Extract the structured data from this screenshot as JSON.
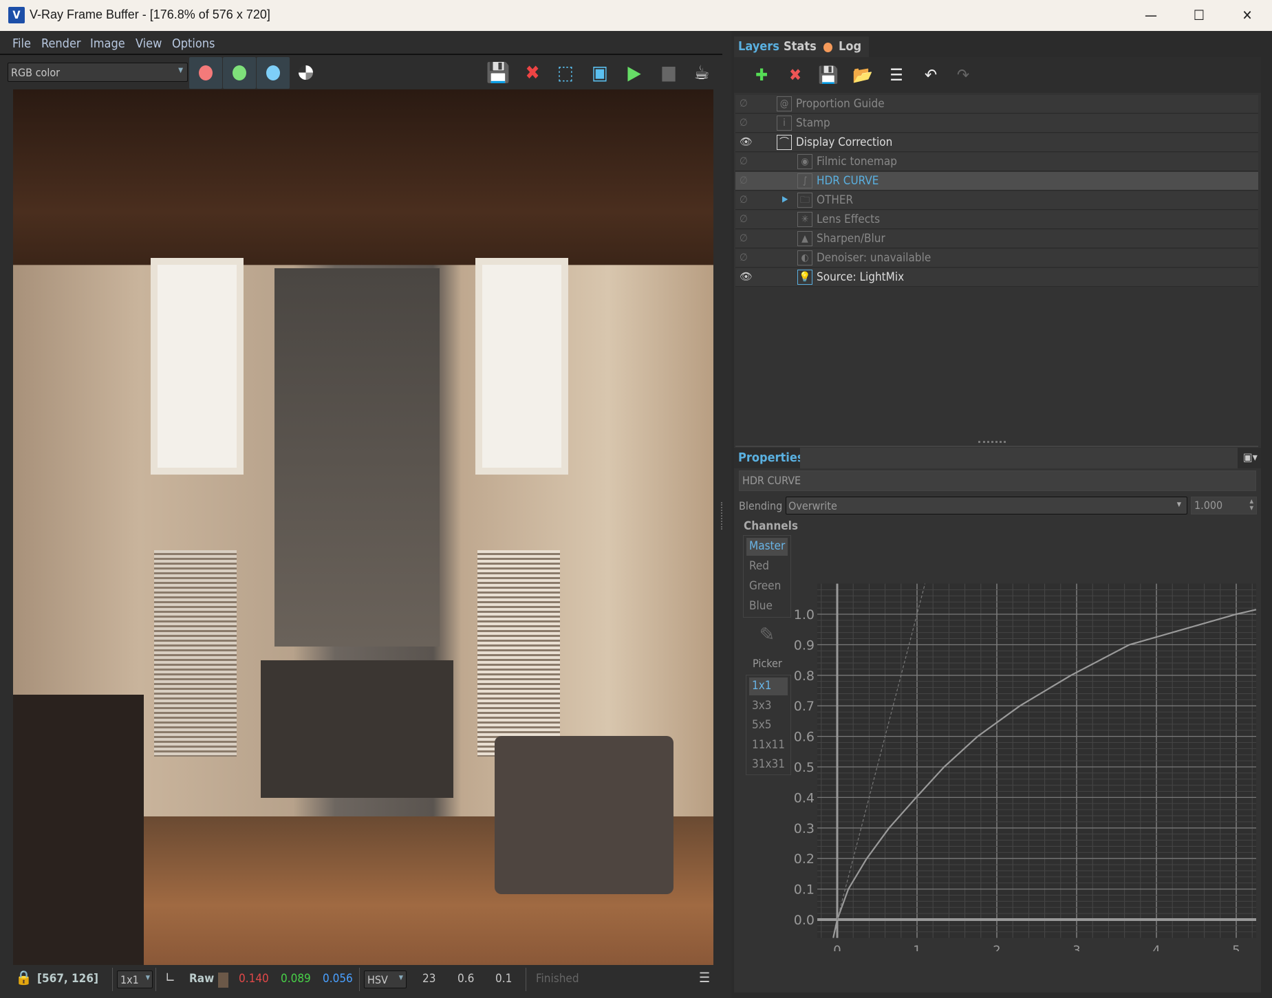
{
  "window": {
    "title": "V-Ray Frame Buffer - [176.8% of 576 x 720]",
    "logo": "V",
    "controls": [
      "minimize",
      "maximize",
      "close"
    ]
  },
  "menu": [
    "File",
    "Render",
    "Image",
    "View",
    "Options"
  ],
  "toolbar": {
    "channel_select": "RGB color",
    "color_buttons": [
      {
        "name": "red-channel",
        "color": "#f47a7a"
      },
      {
        "name": "green-channel",
        "color": "#7ee07a"
      },
      {
        "name": "blue-channel",
        "color": "#7ecff8"
      }
    ],
    "icons": [
      "save-image-icon",
      "clear-image-icon",
      "region-render-icon",
      "track-mouse-icon",
      "start-interactive-render-icon",
      "stop-render-icon",
      "render-icon"
    ]
  },
  "status": {
    "coords": "[567, 126]",
    "sample_size": "1x1",
    "mode": "Raw",
    "swatch_color": "#6b5848",
    "r": "0.140",
    "g": "0.089",
    "b": "0.056",
    "colorspace": "HSV",
    "h": "23",
    "s": "0.6",
    "v": "0.1",
    "state": "Finished"
  },
  "right": {
    "tabs": [
      {
        "label": "Layers",
        "active": true
      },
      {
        "label": "Stats"
      },
      {
        "label": "Log",
        "dot_color": "#f59a5a"
      }
    ],
    "layer_tools": [
      "create-layer-icon",
      "delete-layer-icon",
      "save-layers-icon",
      "load-layers-icon",
      "layer-list-icon",
      "undo-icon",
      "redo-icon"
    ],
    "layers": [
      {
        "label": "Proportion Guide",
        "visible": false,
        "indent": 0,
        "icon": "spiral"
      },
      {
        "label": "Stamp",
        "visible": false,
        "indent": 0,
        "icon": "info"
      },
      {
        "label": "Display Correction",
        "visible": true,
        "indent": 0,
        "icon": "curve"
      },
      {
        "label": "Filmic tonemap",
        "visible": false,
        "indent": 1,
        "icon": "film"
      },
      {
        "label": "HDR CURVE",
        "visible": false,
        "indent": 1,
        "icon": "s-curve",
        "selected": true
      },
      {
        "label": "OTHER",
        "visible": false,
        "indent": 1,
        "icon": "folder",
        "expandable": true
      },
      {
        "label": "Lens Effects",
        "visible": false,
        "indent": 1,
        "icon": "star"
      },
      {
        "label": "Sharpen/Blur",
        "visible": false,
        "indent": 1,
        "icon": "sharpen"
      },
      {
        "label": "Denoiser: unavailable",
        "visible": false,
        "indent": 1,
        "icon": "denoise"
      },
      {
        "label": "Source: LightMix",
        "visible": true,
        "indent": 1,
        "icon": "bulb"
      }
    ],
    "properties": {
      "title": "Properties",
      "layer_name": "HDR CURVE",
      "blending_label": "Blending",
      "blending": "Overwrite",
      "opacity": "1.000",
      "channels_label": "Channels",
      "channels": [
        "Master",
        "Red",
        "Green",
        "Blue"
      ],
      "selected_channel": "Master",
      "picker_label": "Picker",
      "picker_sizes": [
        "1x1",
        "3x3",
        "5x5",
        "11x11",
        "31x31"
      ],
      "selected_picker": "1x1"
    }
  },
  "chart_data": {
    "type": "line",
    "grid": true,
    "xlim": [
      -0.25,
      5.25
    ],
    "ylim": [
      -0.06,
      1.1
    ],
    "x_ticks": [
      "0",
      "1",
      "2",
      "3",
      "4",
      "5"
    ],
    "y_ticks": [
      "0.0",
      "0.1",
      "0.2",
      "0.3",
      "0.4",
      "0.5",
      "0.6",
      "0.7",
      "0.8",
      "0.9",
      "1.0"
    ],
    "series": [
      {
        "style": "solid",
        "x": [
          -0.05,
          0,
          0.14,
          0.37,
          0.65,
          0.99,
          1.34,
          1.76,
          2.29,
          2.93,
          3.66,
          5.0,
          5.25
        ],
        "y": [
          -0.06,
          0,
          0.1,
          0.2,
          0.3,
          0.4,
          0.5,
          0.6,
          0.7,
          0.8,
          0.9,
          1.0,
          1.015
        ]
      },
      {
        "style": "dashed",
        "x": [
          0,
          1.1
        ],
        "y": [
          0,
          1.1
        ]
      }
    ]
  }
}
